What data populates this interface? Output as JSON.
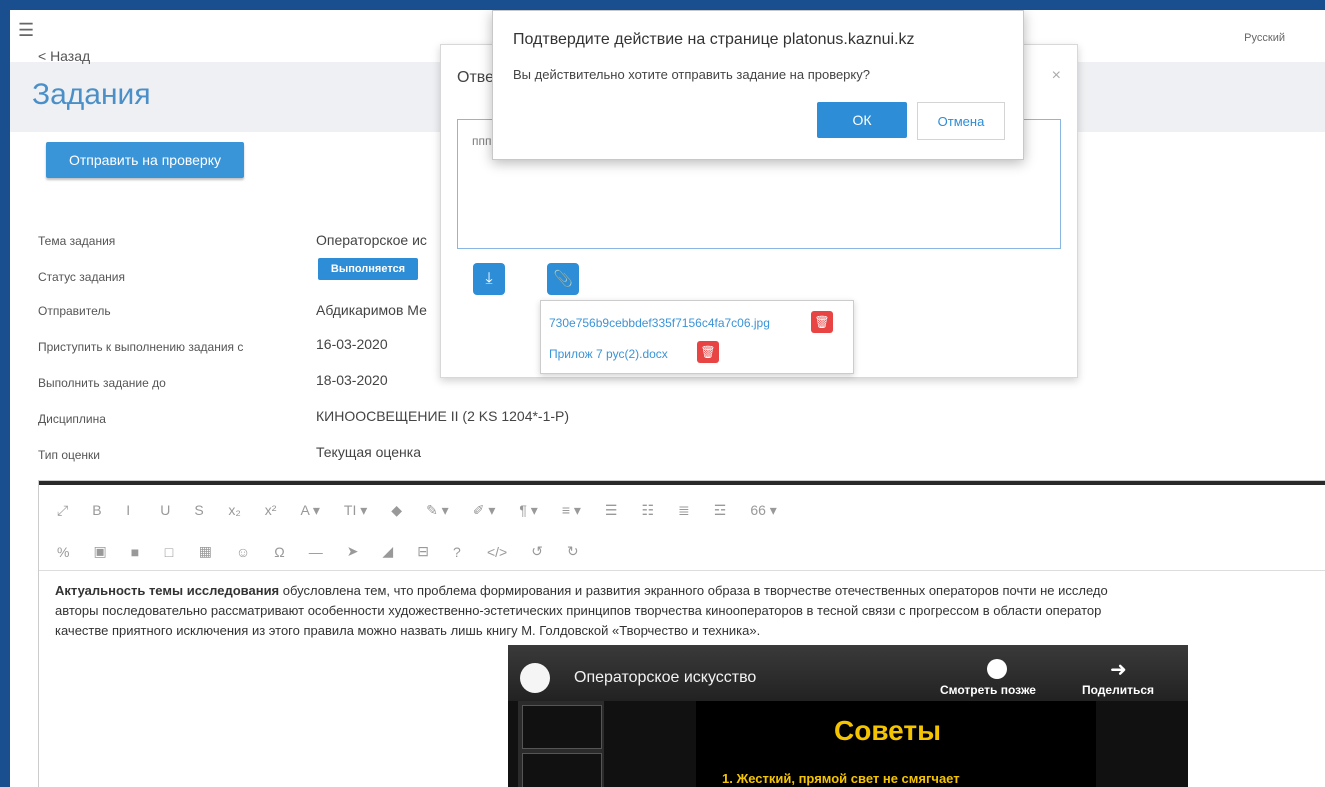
{
  "page": {
    "menu_icon": "menu-icon",
    "language": "Русский",
    "back_link": "< Назад",
    "title": "Задания",
    "send_button": "Отправить на проверку"
  },
  "task": {
    "fields": [
      {
        "label": "Тема задания",
        "value": "Операторское ис"
      },
      {
        "label": "Статус задания",
        "value": "Выполняется"
      },
      {
        "label": "Отправитель",
        "value": "Абдикаримов Ме"
      },
      {
        "label": "Приступить к выполнению задания с",
        "value": "16-03-2020"
      },
      {
        "label": "Выполнить задание до",
        "value": "18-03-2020"
      },
      {
        "label": "Дисциплина",
        "value": "КИНООСВЕЩЕНИЕ II (2 KS 1204*-1-P)"
      },
      {
        "label": "Тип оценки",
        "value": "Текущая оценка"
      }
    ]
  },
  "editor": {
    "body_lead": "Актуальность темы исследования",
    "body_1": " обусловлена тем, что проблема формирования и развития экранного образа в творчестве отечественных операторов почти не исследо",
    "body_2": "авторы последовательно рассматривают особенности художественно-эстетических принципов творчества кинооператоров в тесной связи с прогрессом в области оператор",
    "body_3": "качестве приятного исключения из этого правила можно назвать лишь книгу М. Голдовской «Творчество и техника».",
    "toolbar_row1": [
      "⤢",
      "B",
      "I",
      "U",
      "S",
      "x₂",
      "x²",
      "A ▾",
      "TI ▾",
      "◆",
      "✎ ▾",
      "✐ ▾",
      "¶ ▾",
      "≡ ▾",
      "☰",
      "☷",
      "≣",
      "☲",
      "66 ▾"
    ],
    "toolbar_row2": [
      "%",
      "▣",
      "■",
      "□",
      "▦",
      "☺",
      "Ω",
      "—",
      "➤",
      "◢",
      "⊟",
      "?",
      "</>",
      "↺",
      "↻"
    ]
  },
  "video": {
    "title": "Операторское искусство",
    "watch_later": "Смотреть позже",
    "share": "Поделиться",
    "slide_title": "Советы",
    "slide_line": "1. Жесткий, прямой свет не смягчает"
  },
  "answer_modal": {
    "title": "Отве",
    "close": "×",
    "text": "ппп",
    "files": [
      {
        "name": "730e756b9cebbdef335f7156c4fa7c06.jpg"
      },
      {
        "name": "Прилож 7 рус(2).docx"
      }
    ]
  },
  "confirm_dialog": {
    "title": "Подтвердите действие на странице platonus.kaznui.kz",
    "message": "Вы действительно хотите отправить задание на проверку?",
    "ok": "ОК",
    "cancel": "Отмена"
  }
}
